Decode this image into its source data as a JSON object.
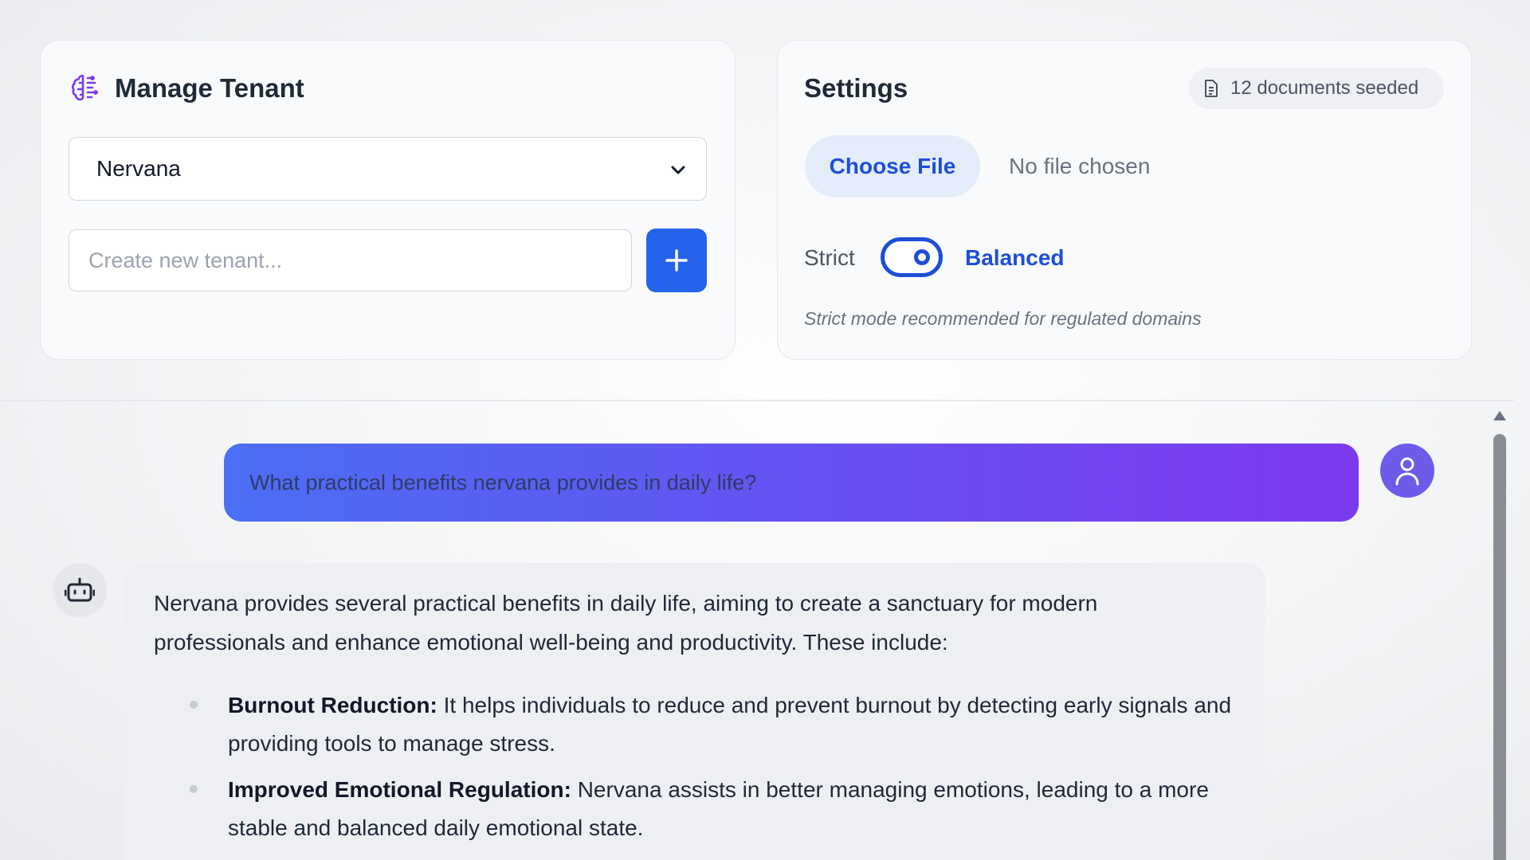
{
  "tenant_card": {
    "title": "Manage Tenant",
    "selected_tenant": "Nervana",
    "new_tenant_placeholder": "Create new tenant...",
    "add_button_icon": "plus-icon"
  },
  "settings_card": {
    "title": "Settings",
    "documents_badge": "12 documents seeded",
    "choose_file_label": "Choose File",
    "file_status": "No file chosen",
    "mode_left_label": "Strict",
    "mode_right_label": "Balanced",
    "mode_selected": "Balanced",
    "mode_hint": "Strict mode recommended for regulated domains"
  },
  "chat": {
    "user_message": "What practical benefits nervana provides in daily life?",
    "assistant_intro": "Nervana provides several practical benefits in daily life, aiming to create a sanctuary for modern professionals and enhance emotional well-being and productivity. These include:",
    "assistant_items": [
      {
        "title": "Burnout Reduction:",
        "text": " It helps individuals to reduce and prevent burnout by detecting early signals and providing tools to manage stress."
      },
      {
        "title": "Improved Emotional Regulation:",
        "text": " Nervana assists in better managing emotions, leading to a more stable and balanced daily emotional state."
      }
    ]
  },
  "colors": {
    "primary": "#2563eb",
    "accent_blue": "#1d4ed8",
    "user_bubble_start": "#4c6ef5",
    "user_bubble_end": "#7c3aed"
  }
}
